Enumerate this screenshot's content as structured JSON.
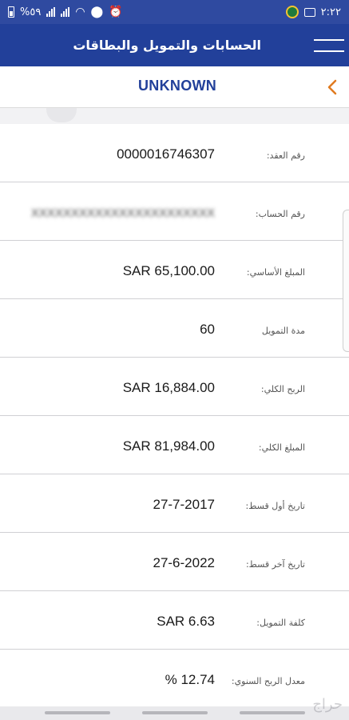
{
  "status_bar": {
    "battery": "%٥٩",
    "time": "٢:٢٢",
    "icons": [
      "battery-icon",
      "signal-icon",
      "signal-icon",
      "wifi-icon",
      "location-icon",
      "alarm-icon",
      "avatar-icon",
      "message-icon"
    ]
  },
  "header": {
    "title": "الحسابات والتمويل والبطاقات",
    "menu_icon": "hamburger-menu-icon"
  },
  "subheader": {
    "title": "UNKNOWN",
    "back_icon": "chevron-left-icon"
  },
  "fields": [
    {
      "label": "رقم العقد:",
      "value": "0000016746307"
    },
    {
      "label": "رقم الحساب:",
      "value": "XXXXXXXXXXXXXXXXXXXXXXX"
    },
    {
      "label": "المبلغ الأساسي:",
      "value": "SAR 65,100.00"
    },
    {
      "label": "مدة التمويل",
      "value": "60"
    },
    {
      "label": "الربح الكلي:",
      "value": "SAR 16,884.00"
    },
    {
      "label": "المبلغ الكلي:",
      "value": "SAR 81,984.00"
    },
    {
      "label": "تاريخ أول قسط:",
      "value": "27-7-2017"
    },
    {
      "label": "تاريخ آخر قسط:",
      "value": "27-6-2022"
    },
    {
      "label": "كلفة التمويل:",
      "value": "SAR 6.63"
    },
    {
      "label": "معدل الربح السنوي:",
      "value": "% 12.74"
    }
  ],
  "watermark": "حراج",
  "colors": {
    "primary": "#22409a",
    "status_bar": "#2f4aa0",
    "accent_chevron": "#e07b20",
    "background": "#f2f2f4"
  }
}
